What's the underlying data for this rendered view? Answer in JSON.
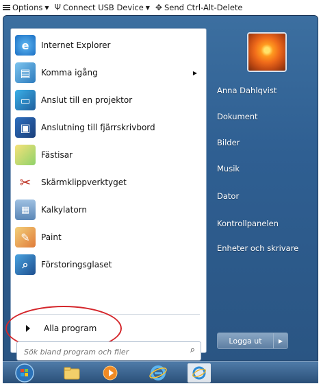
{
  "topbar": {
    "options_label": "Options",
    "connect_label": "Connect USB Device",
    "ctrlaltdel_label": "Send Ctrl-Alt-Delete"
  },
  "programs": [
    {
      "label": "Internet Explorer",
      "icon": "internet-explorer-icon",
      "submenu": false
    },
    {
      "label": "Komma igång",
      "icon": "getting-started-icon",
      "submenu": true
    },
    {
      "label": "Anslut till en projektor",
      "icon": "projector-icon",
      "submenu": false
    },
    {
      "label": "Anslutning till fjärrskrivbord",
      "icon": "remote-desktop-icon",
      "submenu": false
    },
    {
      "label": "Fästisar",
      "icon": "sticky-notes-icon",
      "submenu": false
    },
    {
      "label": "Skärmklippverktyget",
      "icon": "snipping-tool-icon",
      "submenu": false
    },
    {
      "label": "Kalkylatorn",
      "icon": "calculator-icon",
      "submenu": false
    },
    {
      "label": "Paint",
      "icon": "paint-icon",
      "submenu": false
    },
    {
      "label": "Förstoringsglaset",
      "icon": "magnifier-icon",
      "submenu": false
    }
  ],
  "all_programs_label": "Alla program",
  "search": {
    "placeholder": "Sök bland program och filer"
  },
  "right_panel": {
    "items": [
      "Anna Dahlqvist",
      "Dokument",
      "Bilder",
      "Musik",
      "Dator",
      "Kontrollpanelen",
      "Enheter och skrivare"
    ]
  },
  "logoff_label": "Logga ut",
  "taskbar": {
    "buttons": [
      "start-orb-icon",
      "explorer-folder-icon",
      "media-player-icon",
      "internet-explorer-icon",
      "active-window-icon"
    ]
  },
  "colors": {
    "menu_blue": "#2f5f92",
    "highlight_oval": "#d4262b"
  }
}
